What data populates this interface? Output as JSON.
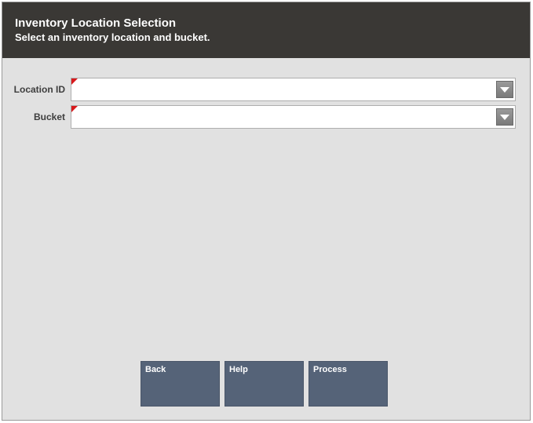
{
  "header": {
    "title": "Inventory Location Selection",
    "subtitle": "Select an inventory location and bucket."
  },
  "fields": {
    "location_id": {
      "label": "Location ID",
      "value": ""
    },
    "bucket": {
      "label": "Bucket",
      "value": ""
    }
  },
  "buttons": {
    "back": "Back",
    "help": "Help",
    "process": "Process"
  },
  "colors": {
    "header_bg": "#3a3835",
    "panel_bg": "#e1e1e1",
    "button_bg": "#556378",
    "required_mark": "#d8191c"
  },
  "icons": {
    "dropdown": "chevron-down-icon",
    "required": "required-indicator-icon"
  }
}
